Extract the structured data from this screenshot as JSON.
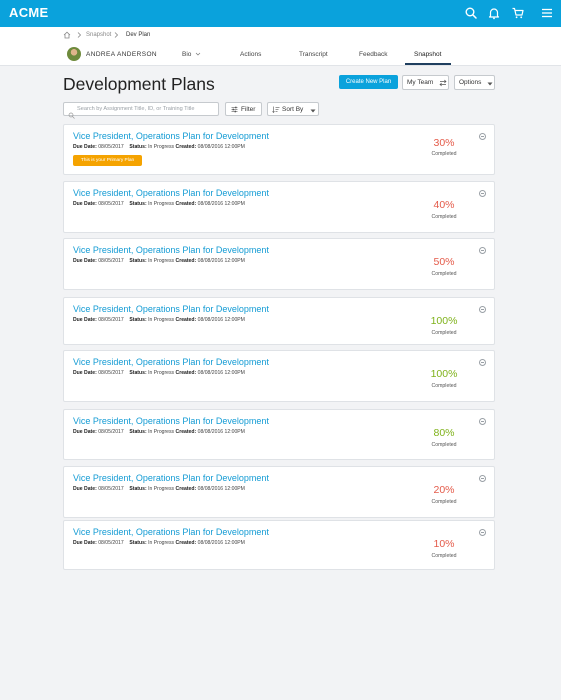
{
  "app": {
    "logo": "ACME"
  },
  "colors": {
    "brand": "#0aa2dc",
    "link": "#139bd4",
    "accent_orange": "#f5a300",
    "pct_low": "#e45b4a",
    "pct_high": "#7fb21b"
  },
  "topbar": {
    "icons": [
      "search-icon",
      "bell-icon",
      "cart-icon",
      "menu-icon"
    ]
  },
  "breadcrumb": {
    "items": [
      "Snapshot",
      "Dev Plan"
    ]
  },
  "user": {
    "name": "ANDREA ANDERSON"
  },
  "tabs": {
    "bio": "Bio",
    "actions": "Actions",
    "transcript": "Transcript",
    "feedback": "Feedback",
    "snapshot": "Snapshot"
  },
  "page": {
    "title": "Development Plans",
    "create_label": "Create New Plan",
    "myteam_label": "My Team",
    "options_label": "Options",
    "filter_label": "Filter",
    "sortby_label": "Sort By",
    "search_placeholder": "Search by Assignment Title, ID, or Training Title"
  },
  "plans": [
    {
      "title": "Vice President, Operations Plan for Development",
      "due_label": "Due Date:",
      "due": "08/05/2017",
      "status_label": "Status:",
      "status": "In Progress",
      "created_label": "Created:",
      "created": "08/08/2016 12:00PM",
      "percent": "30%",
      "percent_label": "Completed",
      "primary": true,
      "primary_label": "This is your Primary Plan"
    },
    {
      "title": "Vice President, Operations Plan for Development",
      "due_label": "Due Date:",
      "due": "08/05/2017",
      "status_label": "Status:",
      "status": "In Progress",
      "created_label": "Created:",
      "created": "08/08/2016 12:00PM",
      "percent": "40%",
      "percent_label": "Completed"
    },
    {
      "title": "Vice President, Operations Plan for Development",
      "due_label": "Due Date:",
      "due": "08/05/2017",
      "status_label": "Status:",
      "status": "In Progress",
      "created_label": "Created:",
      "created": "08/08/2016 12:00PM",
      "percent": "50%",
      "percent_label": "Completed"
    },
    {
      "title": "Vice President, Operations Plan for Development",
      "due_label": "Due Date:",
      "due": "08/05/2017",
      "status_label": "Status:",
      "status": "In Progress",
      "created_label": "Created:",
      "created": "08/08/2016 12:00PM",
      "percent": "100%",
      "percent_label": "Completed"
    },
    {
      "title": "Vice President, Operations Plan for Development",
      "due_label": "Due Date:",
      "due": "08/05/2017",
      "status_label": "Status:",
      "status": "In Progress",
      "created_label": "Created:",
      "created": "08/08/2016 12:00PM",
      "percent": "100%",
      "percent_label": "Completed"
    },
    {
      "title": "Vice President, Operations Plan for Development",
      "due_label": "Due Date:",
      "due": "08/05/2017",
      "status_label": "Status:",
      "status": "In Progress",
      "created_label": "Created:",
      "created": "08/08/2016 12:00PM",
      "percent": "80%",
      "percent_label": "Completed"
    },
    {
      "title": "Vice President, Operations Plan for Development",
      "due_label": "Due Date:",
      "due": "08/05/2017",
      "status_label": "Status:",
      "status": "In Progress",
      "created_label": "Created:",
      "created": "08/08/2016 12:00PM",
      "percent": "20%",
      "percent_label": "Completed"
    },
    {
      "title": "Vice President, Operations Plan for Development",
      "due_label": "Due Date:",
      "due": "08/05/2017",
      "status_label": "Status:",
      "status": "In Progress",
      "created_label": "Created:",
      "created": "08/08/2016 12:00PM",
      "percent": "10%",
      "percent_label": "Completed"
    }
  ]
}
